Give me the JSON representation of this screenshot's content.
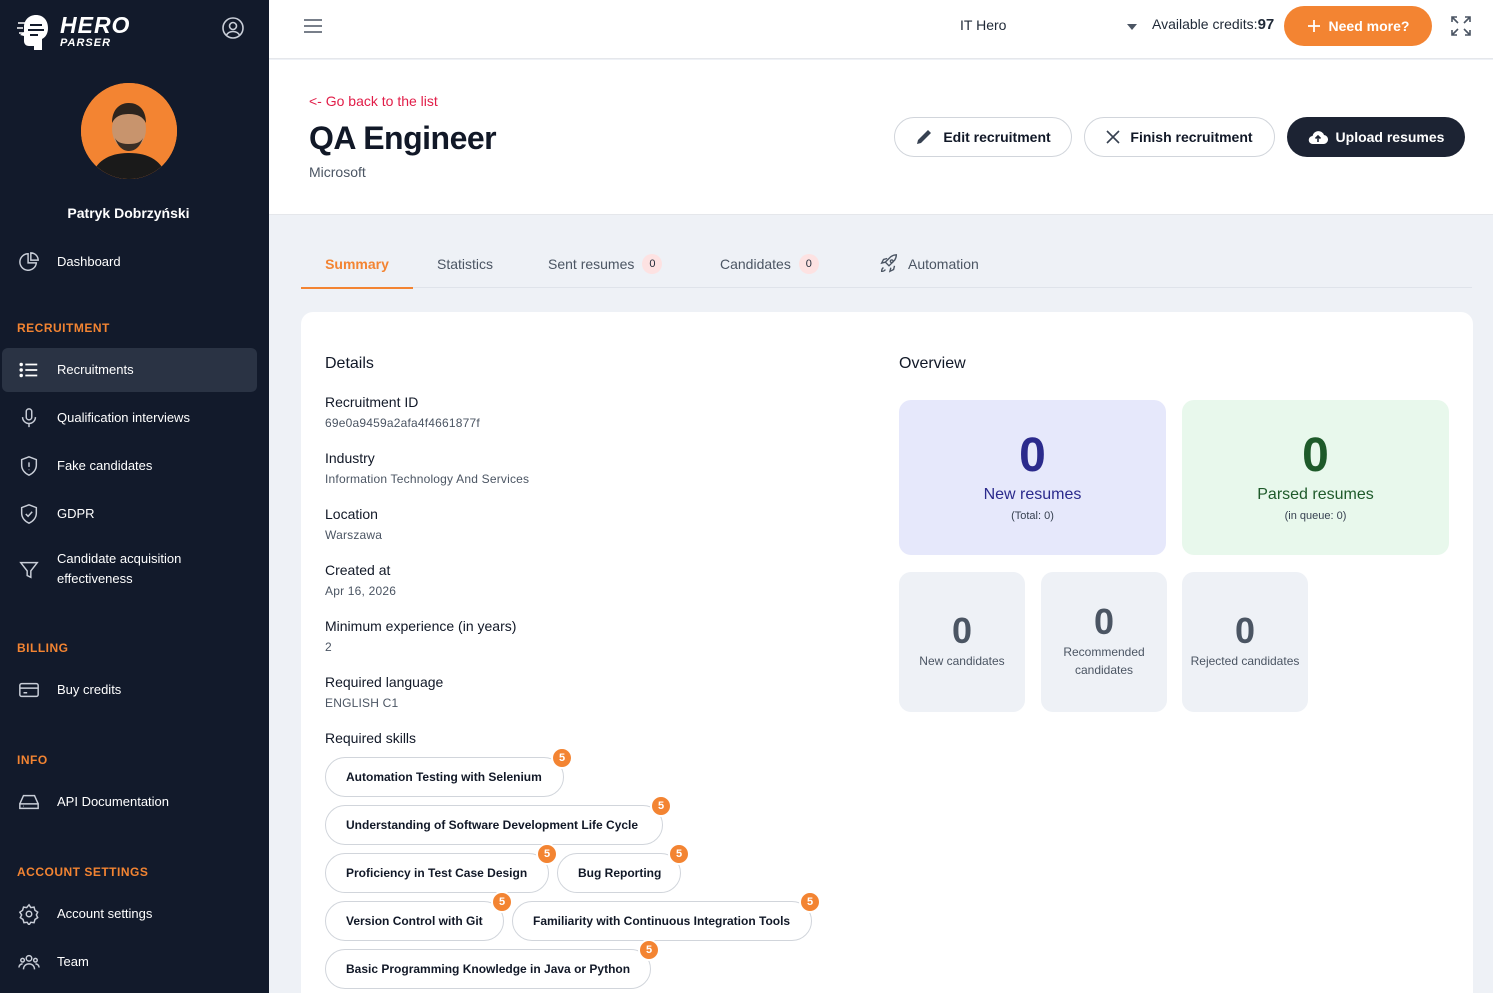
{
  "brand": {
    "name": "HERO",
    "sub": "PARSER"
  },
  "user": {
    "name": "Patryk Dobrzyński"
  },
  "nav": {
    "dashboard": "Dashboard",
    "sections": {
      "recruitment": "RECRUITMENT",
      "billing": "BILLING",
      "info": "INFO",
      "account": "ACCOUNT SETTINGS"
    },
    "recruitments": "Recruitments",
    "qualification": "Qualification interviews",
    "fake": "Fake candidates",
    "gdpr": "GDPR",
    "acquisition_1": "Candidate acquisition",
    "acquisition_2": "effectiveness",
    "buy_credits": "Buy credits",
    "api_docs": "API Documentation",
    "account_settings": "Account settings",
    "team": "Team"
  },
  "topbar": {
    "org": "IT Hero",
    "credits_label": "Available credits:",
    "credits_value": "97",
    "need_more": "Need more?"
  },
  "header": {
    "back": "<- Go back to the list",
    "title": "QA Engineer",
    "company": "Microsoft",
    "edit": "Edit recruitment",
    "finish": "Finish recruitment",
    "upload": "Upload resumes"
  },
  "tabs": {
    "summary": "Summary",
    "statistics": "Statistics",
    "sent": "Sent resumes",
    "sent_count": "0",
    "candidates": "Candidates",
    "candidates_count": "0",
    "automation": "Automation"
  },
  "details": {
    "title": "Details",
    "id_label": "Recruitment ID",
    "id_value": "69e0a9459a2afa4f4661877f",
    "industry_label": "Industry",
    "industry_value": "Information Technology And Services",
    "location_label": "Location",
    "location_value": "Warszawa",
    "created_label": "Created at",
    "created_value": "Apr 16, 2026",
    "exp_label": "Minimum experience (in years)",
    "exp_value": "2",
    "lang_label": "Required language",
    "lang_value": "ENGLISH C1",
    "skills_label": "Required skills",
    "skills": [
      {
        "name": "Automation Testing with Selenium",
        "level": "5"
      },
      {
        "name": "Understanding of Software Development Life Cycle",
        "level": "5"
      },
      {
        "name": "Proficiency in Test Case Design",
        "level": "5"
      },
      {
        "name": "Bug Reporting",
        "level": "5"
      },
      {
        "name": "Version Control with Git",
        "level": "5"
      },
      {
        "name": "Familiarity with Continuous Integration Tools",
        "level": "5"
      },
      {
        "name": "Basic Programming Knowledge in Java or Python",
        "level": "5"
      }
    ]
  },
  "overview": {
    "title": "Overview",
    "new_resumes": {
      "value": "0",
      "label": "New resumes",
      "sub": "(Total: 0)"
    },
    "parsed_resumes": {
      "value": "0",
      "label": "Parsed resumes",
      "sub": "(in queue: 0)"
    },
    "new_candidates": {
      "value": "0",
      "label": "New candidates"
    },
    "recommended": {
      "value": "0",
      "label_1": "Recommended",
      "label_2": "candidates"
    },
    "rejected": {
      "value": "0",
      "label": "Rejected candidates"
    }
  },
  "colors": {
    "accent": "#f38432",
    "sidebar": "#121a2b",
    "link": "#e11d48"
  }
}
